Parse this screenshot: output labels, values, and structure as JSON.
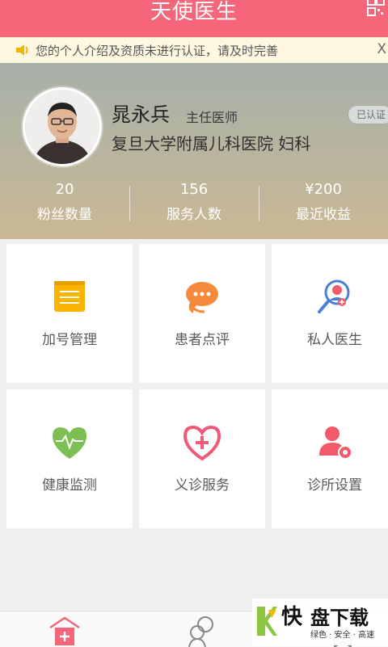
{
  "header": {
    "title": "天使医生",
    "qr_icon": "qr-code-icon"
  },
  "notice": {
    "text": "您的个人介绍及资质未进行认证，请及时完善",
    "close": "X",
    "icon": "speaker-icon"
  },
  "profile": {
    "name": "晁永兵",
    "role": "主任医师",
    "hospital": "复旦大学附属儿科医院   妇科",
    "verified": "已认证",
    "stats": [
      {
        "value": "20",
        "label": "粉丝数量"
      },
      {
        "value": "156",
        "label": "服务人数"
      },
      {
        "value": "¥200",
        "label": "最近收益"
      }
    ]
  },
  "grid": [
    {
      "label": "加号管理",
      "icon": "clipboard-icon",
      "color": "#f9b400"
    },
    {
      "label": "患者点评",
      "icon": "chat-bubble-icon",
      "color": "#f58a3c"
    },
    {
      "label": "私人医生",
      "icon": "doctor-search-icon",
      "color": "#4a7fd4"
    },
    {
      "label": "健康监测",
      "icon": "heart-pulse-icon",
      "color": "#7cc053"
    },
    {
      "label": "义诊服务",
      "icon": "heart-plus-icon",
      "color": "#f05a78"
    },
    {
      "label": "诊所设置",
      "icon": "user-gear-icon",
      "color": "#f05a6a"
    }
  ],
  "watermark": {
    "brand1": "快",
    "brand2": "盘下载",
    "sub": "绿色 · 安全 · 高速"
  },
  "colors": {
    "accent": "#f5667a",
    "notice_bg": "#fff8e1"
  }
}
